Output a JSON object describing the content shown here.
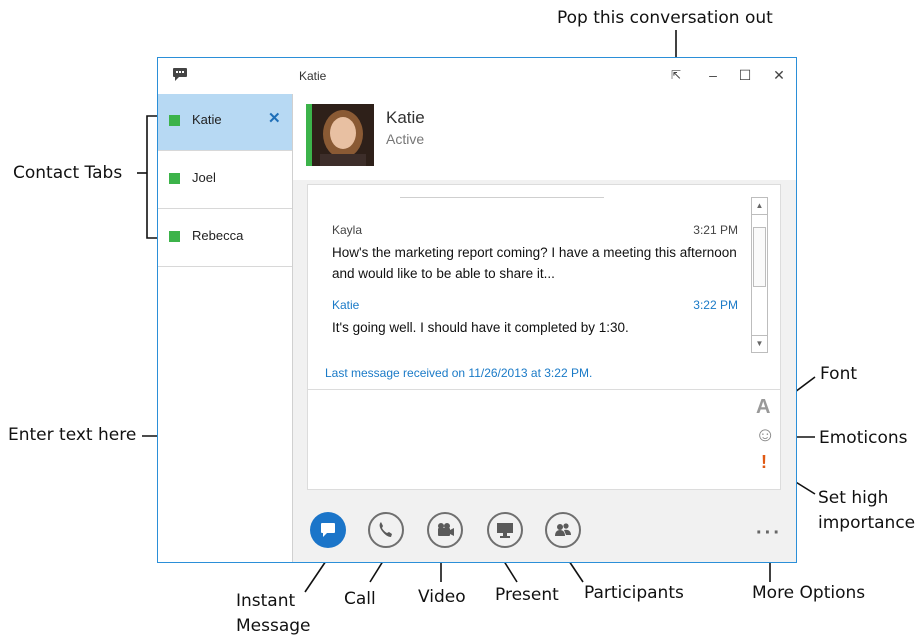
{
  "window": {
    "title": "Katie",
    "minimize": "–",
    "maximize": "☐",
    "close": "✕",
    "popout": "⇱"
  },
  "sidebar": {
    "tabs": [
      {
        "label": "Katie",
        "close": "✕"
      },
      {
        "label": "Joel"
      },
      {
        "label": "Rebecca"
      }
    ]
  },
  "contact": {
    "name": "Katie",
    "status": "Active"
  },
  "conversation": {
    "messages": [
      {
        "sender": "Kayla",
        "time": "3:21 PM",
        "text": "How's the marketing report coming? I have a meeting this afternoon and would like to be able to share it..."
      },
      {
        "sender": "Katie",
        "time": "3:22 PM",
        "text": "It's going well. I should have it completed by 1:30."
      }
    ],
    "last_message": "Last message received on 11/26/2013 at 3:22 PM."
  },
  "compose": {
    "font": "A",
    "emoticon": "☺",
    "importance": "!"
  },
  "actions": {
    "more": "···"
  },
  "callouts": {
    "pop_out": "Pop this conversation out",
    "contact_tabs": "Contact Tabs",
    "enter_text": "Enter text here",
    "font": "Font",
    "emoticons": "Emoticons",
    "set_high_importance_1": "Set high",
    "set_high_importance_2": "importance",
    "instant_message_1": "Instant",
    "instant_message_2": "Message",
    "call": "Call",
    "video": "Video",
    "present": "Present",
    "participants": "Participants",
    "more_options": "More Options"
  },
  "colors": {
    "window_border": "#2b8fd8",
    "active_tab": "#b7d9f3",
    "presence_available": "#3cb34a",
    "link_blue": "#1a7ac7",
    "primary_button": "#1b75c9",
    "importance": "#e05a14"
  }
}
